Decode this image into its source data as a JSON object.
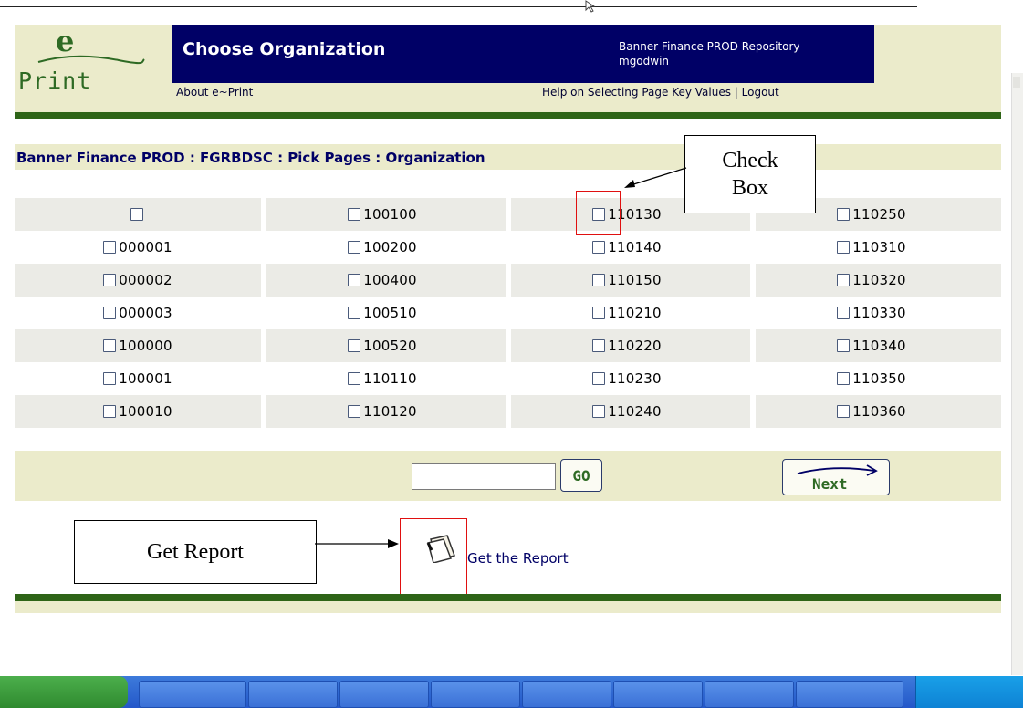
{
  "header": {
    "logo_top": "e",
    "logo_bottom": "Print",
    "title": "Choose Organization",
    "repository": "Banner Finance PROD Repository",
    "user": "mgodwin",
    "about_link": "About e~Print",
    "help_link": "Help on Selecting Page Key Values",
    "help_sep": " | ",
    "logout_link": "Logout"
  },
  "breadcrumb": "Banner Finance PROD : FGRBDSC : Pick Pages : Organization",
  "grid": {
    "rows": [
      [
        "",
        "100100",
        "110130",
        "110250"
      ],
      [
        "000001",
        "100200",
        "110140",
        "110310"
      ],
      [
        "000002",
        "100400",
        "110150",
        "110320"
      ],
      [
        "000003",
        "100510",
        "110210",
        "110330"
      ],
      [
        "100000",
        "100520",
        "110220",
        "110340"
      ],
      [
        "100001",
        "110110",
        "110230",
        "110350"
      ],
      [
        "100010",
        "110120",
        "110240",
        "110360"
      ]
    ]
  },
  "go_bar": {
    "input_value": "",
    "go_label": "GO",
    "next_label": "Next"
  },
  "report": {
    "link_text": "Get the Report",
    "icon": "document-icon"
  },
  "annotations": {
    "check_box": "Check Box",
    "get_report": "Get Report",
    "arrow_color": "#000000",
    "highlight_color": "#e01010"
  },
  "colors": {
    "title_bar": "#000066",
    "header_bg": "#ebebcb",
    "green_bar": "#2e6417",
    "row_shade": "#ebebe6"
  }
}
